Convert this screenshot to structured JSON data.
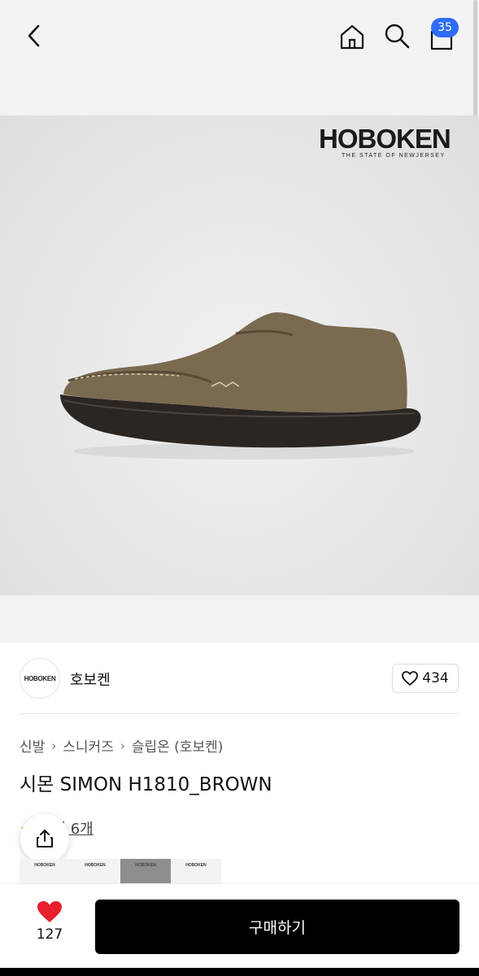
{
  "header": {
    "cart_count": "35"
  },
  "hero": {
    "brand_logo_text": "HOBOKEN",
    "brand_logo_tagline": "THE STATE OF NEWJERSEY"
  },
  "brand": {
    "avatar_text": "HOBOKEN",
    "name": "호보켄",
    "like_count": "434"
  },
  "breadcrumb": {
    "items": [
      "신발",
      "스니커즈",
      "슬립온 (호보켄)"
    ]
  },
  "product": {
    "title": "시몬 SIMON H1810_BROWN",
    "review_label": "후기 6개"
  },
  "thumbnails": {
    "labels": [
      "HOBOKEN",
      "HOBOKEN",
      "HOBOKEN",
      "HOBOKEN"
    ]
  },
  "bottom_bar": {
    "wish_count": "127",
    "buy_label": "구매하기"
  },
  "colors": {
    "badge": "#2f6cf6",
    "heart": "#e8202c",
    "star": "#f4a400"
  }
}
